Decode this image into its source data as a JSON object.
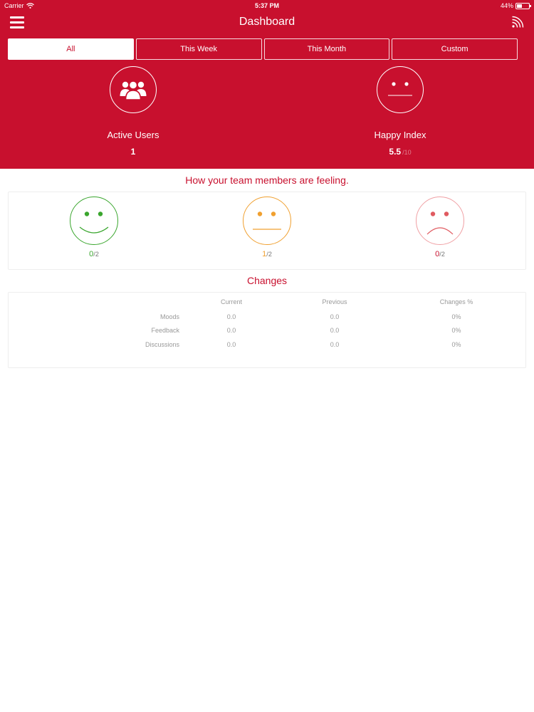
{
  "status_bar": {
    "carrier": "Carrier",
    "time": "5:37 PM",
    "battery": "44%"
  },
  "nav": {
    "title": "Dashboard",
    "menu_icon": "hamburger-menu-icon",
    "feed_icon": "rss-feed-icon"
  },
  "tabs": [
    {
      "label": "All",
      "active": true
    },
    {
      "label": "This Week",
      "active": false
    },
    {
      "label": "This Month",
      "active": false
    },
    {
      "label": "Custom",
      "active": false
    }
  ],
  "metrics": {
    "active_users": {
      "label": "Active Users",
      "value": "1",
      "icon": "group-users-icon"
    },
    "happy_index": {
      "label": "Happy Index",
      "value": "5.5",
      "suffix": "/10",
      "icon": "neutral-face-icon"
    }
  },
  "feeling": {
    "title": "How your team members are feeling.",
    "happy": {
      "count": "0",
      "total": "2",
      "color": "#3aa62e"
    },
    "neutral": {
      "count": "1",
      "total": "2",
      "color": "#f0a030"
    },
    "sad": {
      "count": "0",
      "total": "2",
      "color": "#e05a60"
    }
  },
  "changes": {
    "title": "Changes",
    "columns": {
      "current": "Current",
      "previous": "Previous",
      "changes": "Changes %"
    },
    "rows": [
      {
        "label": "Moods",
        "current": "0.0",
        "previous": "0.0",
        "change": "0%"
      },
      {
        "label": "Feedback",
        "current": "0.0",
        "previous": "0.0",
        "change": "0%"
      },
      {
        "label": "Discussions",
        "current": "0.0",
        "previous": "0.0",
        "change": "0%"
      }
    ]
  },
  "colors": {
    "brand": "#c8102e",
    "background": "#ffffff"
  }
}
